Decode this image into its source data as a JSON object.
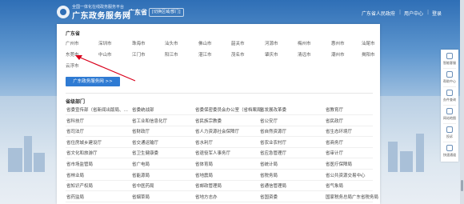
{
  "header": {
    "logo_tagline": "全国一体化在线政务服务平台",
    "logo_title": "广东政务服务网",
    "province": "广东省",
    "switch_label": "[切换区域/部门]",
    "nav": [
      "广东省人民政府",
      "用户中心",
      "登录"
    ]
  },
  "province_section": {
    "title": "广东省",
    "cities": [
      "广州市",
      "深圳市",
      "珠海市",
      "汕头市",
      "佛山市",
      "韶关市",
      "河源市",
      "梅州市",
      "惠州市",
      "汕尾市",
      "东莞市",
      "中山市",
      "江门市",
      "阳江市",
      "湛江市",
      "茂名市",
      "肇庆市",
      "清远市",
      "潮州市",
      "揭阳市",
      "云浮市"
    ],
    "all_button": "广东政务服务网 >>"
  },
  "dept_section": {
    "title": "省级部门",
    "items": [
      "省委宣传部（省新闻出版局、…",
      "省委统战部",
      "省委保密委员会办公室（省档案局）",
      "省发展改革委",
      "省教育厅",
      "省科技厅",
      "省工业和信息化厅",
      "省民族宗教委",
      "省公安厅",
      "省民政厅",
      "省司法厅",
      "省财政厅",
      "省人力资源社会保障厅",
      "省自然资源厅",
      "省生态环境厅",
      "省住房城乡建设厅",
      "省交通运输厅",
      "省水利厅",
      "省农业农村厅",
      "省商务厅",
      "省文化和旅游厅",
      "省卫生健康委",
      "省退役军人事务厅",
      "省应急管理厅",
      "省审计厅",
      "省市场监管局",
      "省广电局",
      "省体育局",
      "省统计局",
      "省医疗保障局",
      "省林业局",
      "省能源局",
      "省地震局",
      "省税务局",
      "省公共资源交易中心",
      "省知识产权局",
      "省中医药局",
      "省邮政管理局",
      "省通信管理局",
      "省气象局",
      "省药监局",
      "省烟草局",
      "省地方志办",
      "省国资委",
      "国家税务总局广东省税务局"
    ]
  },
  "float_bar": [
    "智能客服",
    "帮助中心",
    "办件查询",
    "网站地图",
    "投诉",
    "快速通道"
  ],
  "colors": {
    "brand_blue": "#2f6fb6",
    "button_blue": "#2f7bd3",
    "arrow_red": "#d9001b"
  }
}
